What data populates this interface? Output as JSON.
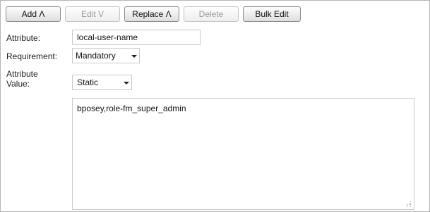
{
  "toolbar": {
    "add_label": "Add Λ",
    "edit_label": "Edit V",
    "replace_label": "Replace Λ",
    "delete_label": "Delete",
    "bulk_edit_label": "Bulk Edit"
  },
  "form": {
    "attribute_label": "Attribute:",
    "attribute_value": "local-user-name",
    "requirement_label": "Requirement:",
    "requirement_value": "Mandatory",
    "attribute_value_label_line1": "Attribute",
    "attribute_value_label_line2": "Value:",
    "value_type": "Static",
    "value_text": "bposey,role-fm_super_admin"
  },
  "icons": {
    "dropdown": "chevron-down-icon",
    "resize": "resize-grip-icon"
  }
}
